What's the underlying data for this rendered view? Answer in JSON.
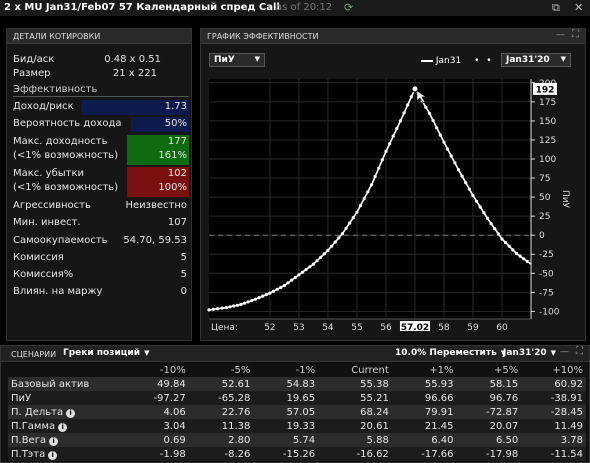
{
  "titlebar": {
    "title": "2 x MU Jan31/Feb07 57 Календарный спред Call",
    "as_of": "as of 20:12"
  },
  "quote": {
    "header": "ДЕТАЛИ КОТИРОВКИ",
    "bid_ask_label": "Бид/аск",
    "bid_ask": "0.48 x 0.51",
    "size_label": "Размер",
    "size": "21 x 221",
    "efficiency_header": "Эффективность",
    "return_risk_label": "Доход/риск",
    "return_risk": "1.73",
    "prob_profit_label": "Вероятность дохода",
    "prob_profit": "50%",
    "max_profit_label1": "Макс. доходность",
    "max_profit_label2": "(<1% возможность)",
    "max_profit": "177",
    "max_profit_pct": "161%",
    "max_loss_label1": "Макс. убытки",
    "max_loss_label2": "(<1% возможность)",
    "max_loss": "102",
    "max_loss_pct": "100%",
    "aggr_label": "Агрессивность",
    "aggr": "Неизвестно",
    "min_inv_label": "Мин. инвест.",
    "min_inv": "107",
    "breakeven_label": "Самоокупаемость",
    "breakeven": "54.70, 59.53",
    "commission_label": "Комиссия",
    "commission": "5",
    "commission_pct_label": "Комиссия%",
    "commission_pct": "5",
    "margin_label": "Влиян. на маржу",
    "margin": "0"
  },
  "chart_panel": {
    "header": "ГРАФИК ЭФФЕКТИВНОСТИ",
    "mode_select": "ПиУ",
    "legend_series": "Jan31",
    "date_select": "Jan31'20",
    "price_label": "Цена:",
    "current_price": "57.02",
    "y_flag": "192",
    "y_axis_label": "ПиУ"
  },
  "chart_data": {
    "type": "line",
    "x_ticks": [
      52,
      53,
      54,
      55,
      56,
      57,
      58,
      59,
      60
    ],
    "y_ticks": [
      200,
      175,
      150,
      125,
      100,
      75,
      50,
      25,
      0,
      -25,
      -50,
      -75,
      -100
    ],
    "xlim": [
      49.9,
      61.0
    ],
    "ylim": [
      -110,
      205
    ],
    "peak": {
      "x": 57.0,
      "y": 192
    },
    "series": [
      {
        "name": "Jan31",
        "x": [
          49.9,
          50.5,
          51.0,
          51.5,
          52.0,
          52.5,
          53.0,
          53.5,
          54.0,
          54.5,
          55.0,
          55.5,
          56.0,
          56.5,
          57.0,
          57.5,
          58.0,
          58.5,
          59.0,
          59.5,
          60.0,
          60.5,
          61.0
        ],
        "y": [
          -98,
          -95,
          -91,
          -84,
          -76,
          -66,
          -52,
          -38,
          -20,
          2,
          30,
          66,
          110,
          150,
          192,
          160,
          122,
          86,
          52,
          22,
          -5,
          -24,
          -38
        ]
      }
    ]
  },
  "scenarios": {
    "header": "СЦЕНАРИИ",
    "group_select": "Греки позиций",
    "move_select": "10.0% Переместить",
    "date_select": "Jan31'20",
    "columns": [
      "-10%",
      "-5%",
      "-1%",
      "Current",
      "+1%",
      "+5%",
      "+10%"
    ],
    "rows": [
      {
        "label": "Базовый актив",
        "values": [
          "49.84",
          "52.61",
          "54.83",
          "55.38",
          "55.93",
          "58.15",
          "60.92"
        ]
      },
      {
        "label": "ПиУ",
        "values": [
          "-97.27",
          "-65.28",
          "19.65",
          "55.21",
          "96.66",
          "96.76",
          "-38.91"
        ]
      },
      {
        "label": "П. Дельта",
        "values": [
          "4.06",
          "22.76",
          "57.05",
          "68.24",
          "79.91",
          "-72.87",
          "-28.45"
        ]
      },
      {
        "label": "П.Гамма",
        "values": [
          "3.04",
          "11.38",
          "19.33",
          "20.61",
          "21.45",
          "20.07",
          "11.49"
        ]
      },
      {
        "label": "П.Вега",
        "values": [
          "0.69",
          "2.80",
          "5.74",
          "5.88",
          "6.40",
          "6.50",
          "3.78"
        ]
      },
      {
        "label": "П.Тэта",
        "values": [
          "-1.98",
          "-8.26",
          "-15.26",
          "-16.62",
          "-17.66",
          "-17.98",
          "-11.54"
        ]
      }
    ]
  },
  "colors": {
    "navy_box": "#0d1a4d",
    "green_box": "#0f6b10",
    "red_box": "#7a0f0f"
  }
}
